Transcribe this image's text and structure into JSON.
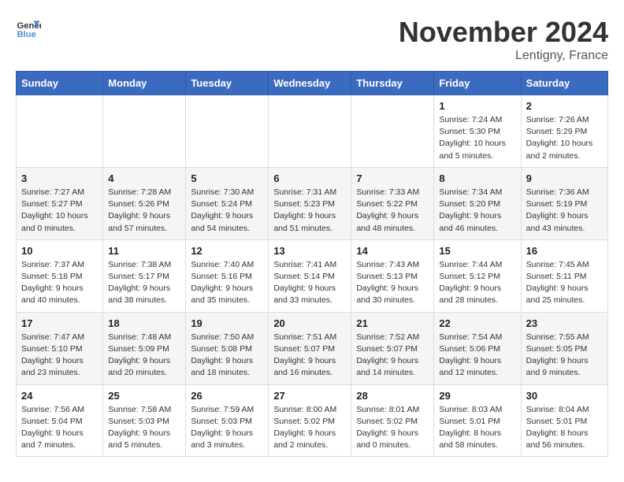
{
  "header": {
    "logo_line1": "General",
    "logo_line2": "Blue",
    "month_title": "November 2024",
    "location": "Lentigny, France"
  },
  "weekdays": [
    "Sunday",
    "Monday",
    "Tuesday",
    "Wednesday",
    "Thursday",
    "Friday",
    "Saturday"
  ],
  "weeks": [
    [
      {
        "day": "",
        "info": ""
      },
      {
        "day": "",
        "info": ""
      },
      {
        "day": "",
        "info": ""
      },
      {
        "day": "",
        "info": ""
      },
      {
        "day": "",
        "info": ""
      },
      {
        "day": "1",
        "info": "Sunrise: 7:24 AM\nSunset: 5:30 PM\nDaylight: 10 hours\nand 5 minutes."
      },
      {
        "day": "2",
        "info": "Sunrise: 7:26 AM\nSunset: 5:29 PM\nDaylight: 10 hours\nand 2 minutes."
      }
    ],
    [
      {
        "day": "3",
        "info": "Sunrise: 7:27 AM\nSunset: 5:27 PM\nDaylight: 10 hours\nand 0 minutes."
      },
      {
        "day": "4",
        "info": "Sunrise: 7:28 AM\nSunset: 5:26 PM\nDaylight: 9 hours\nand 57 minutes."
      },
      {
        "day": "5",
        "info": "Sunrise: 7:30 AM\nSunset: 5:24 PM\nDaylight: 9 hours\nand 54 minutes."
      },
      {
        "day": "6",
        "info": "Sunrise: 7:31 AM\nSunset: 5:23 PM\nDaylight: 9 hours\nand 51 minutes."
      },
      {
        "day": "7",
        "info": "Sunrise: 7:33 AM\nSunset: 5:22 PM\nDaylight: 9 hours\nand 48 minutes."
      },
      {
        "day": "8",
        "info": "Sunrise: 7:34 AM\nSunset: 5:20 PM\nDaylight: 9 hours\nand 46 minutes."
      },
      {
        "day": "9",
        "info": "Sunrise: 7:36 AM\nSunset: 5:19 PM\nDaylight: 9 hours\nand 43 minutes."
      }
    ],
    [
      {
        "day": "10",
        "info": "Sunrise: 7:37 AM\nSunset: 5:18 PM\nDaylight: 9 hours\nand 40 minutes."
      },
      {
        "day": "11",
        "info": "Sunrise: 7:38 AM\nSunset: 5:17 PM\nDaylight: 9 hours\nand 38 minutes."
      },
      {
        "day": "12",
        "info": "Sunrise: 7:40 AM\nSunset: 5:16 PM\nDaylight: 9 hours\nand 35 minutes."
      },
      {
        "day": "13",
        "info": "Sunrise: 7:41 AM\nSunset: 5:14 PM\nDaylight: 9 hours\nand 33 minutes."
      },
      {
        "day": "14",
        "info": "Sunrise: 7:43 AM\nSunset: 5:13 PM\nDaylight: 9 hours\nand 30 minutes."
      },
      {
        "day": "15",
        "info": "Sunrise: 7:44 AM\nSunset: 5:12 PM\nDaylight: 9 hours\nand 28 minutes."
      },
      {
        "day": "16",
        "info": "Sunrise: 7:45 AM\nSunset: 5:11 PM\nDaylight: 9 hours\nand 25 minutes."
      }
    ],
    [
      {
        "day": "17",
        "info": "Sunrise: 7:47 AM\nSunset: 5:10 PM\nDaylight: 9 hours\nand 23 minutes."
      },
      {
        "day": "18",
        "info": "Sunrise: 7:48 AM\nSunset: 5:09 PM\nDaylight: 9 hours\nand 20 minutes."
      },
      {
        "day": "19",
        "info": "Sunrise: 7:50 AM\nSunset: 5:08 PM\nDaylight: 9 hours\nand 18 minutes."
      },
      {
        "day": "20",
        "info": "Sunrise: 7:51 AM\nSunset: 5:07 PM\nDaylight: 9 hours\nand 16 minutes."
      },
      {
        "day": "21",
        "info": "Sunrise: 7:52 AM\nSunset: 5:07 PM\nDaylight: 9 hours\nand 14 minutes."
      },
      {
        "day": "22",
        "info": "Sunrise: 7:54 AM\nSunset: 5:06 PM\nDaylight: 9 hours\nand 12 minutes."
      },
      {
        "day": "23",
        "info": "Sunrise: 7:55 AM\nSunset: 5:05 PM\nDaylight: 9 hours\nand 9 minutes."
      }
    ],
    [
      {
        "day": "24",
        "info": "Sunrise: 7:56 AM\nSunset: 5:04 PM\nDaylight: 9 hours\nand 7 minutes."
      },
      {
        "day": "25",
        "info": "Sunrise: 7:58 AM\nSunset: 5:03 PM\nDaylight: 9 hours\nand 5 minutes."
      },
      {
        "day": "26",
        "info": "Sunrise: 7:59 AM\nSunset: 5:03 PM\nDaylight: 9 hours\nand 3 minutes."
      },
      {
        "day": "27",
        "info": "Sunrise: 8:00 AM\nSunset: 5:02 PM\nDaylight: 9 hours\nand 2 minutes."
      },
      {
        "day": "28",
        "info": "Sunrise: 8:01 AM\nSunset: 5:02 PM\nDaylight: 9 hours\nand 0 minutes."
      },
      {
        "day": "29",
        "info": "Sunrise: 8:03 AM\nSunset: 5:01 PM\nDaylight: 8 hours\nand 58 minutes."
      },
      {
        "day": "30",
        "info": "Sunrise: 8:04 AM\nSunset: 5:01 PM\nDaylight: 8 hours\nand 56 minutes."
      }
    ]
  ]
}
